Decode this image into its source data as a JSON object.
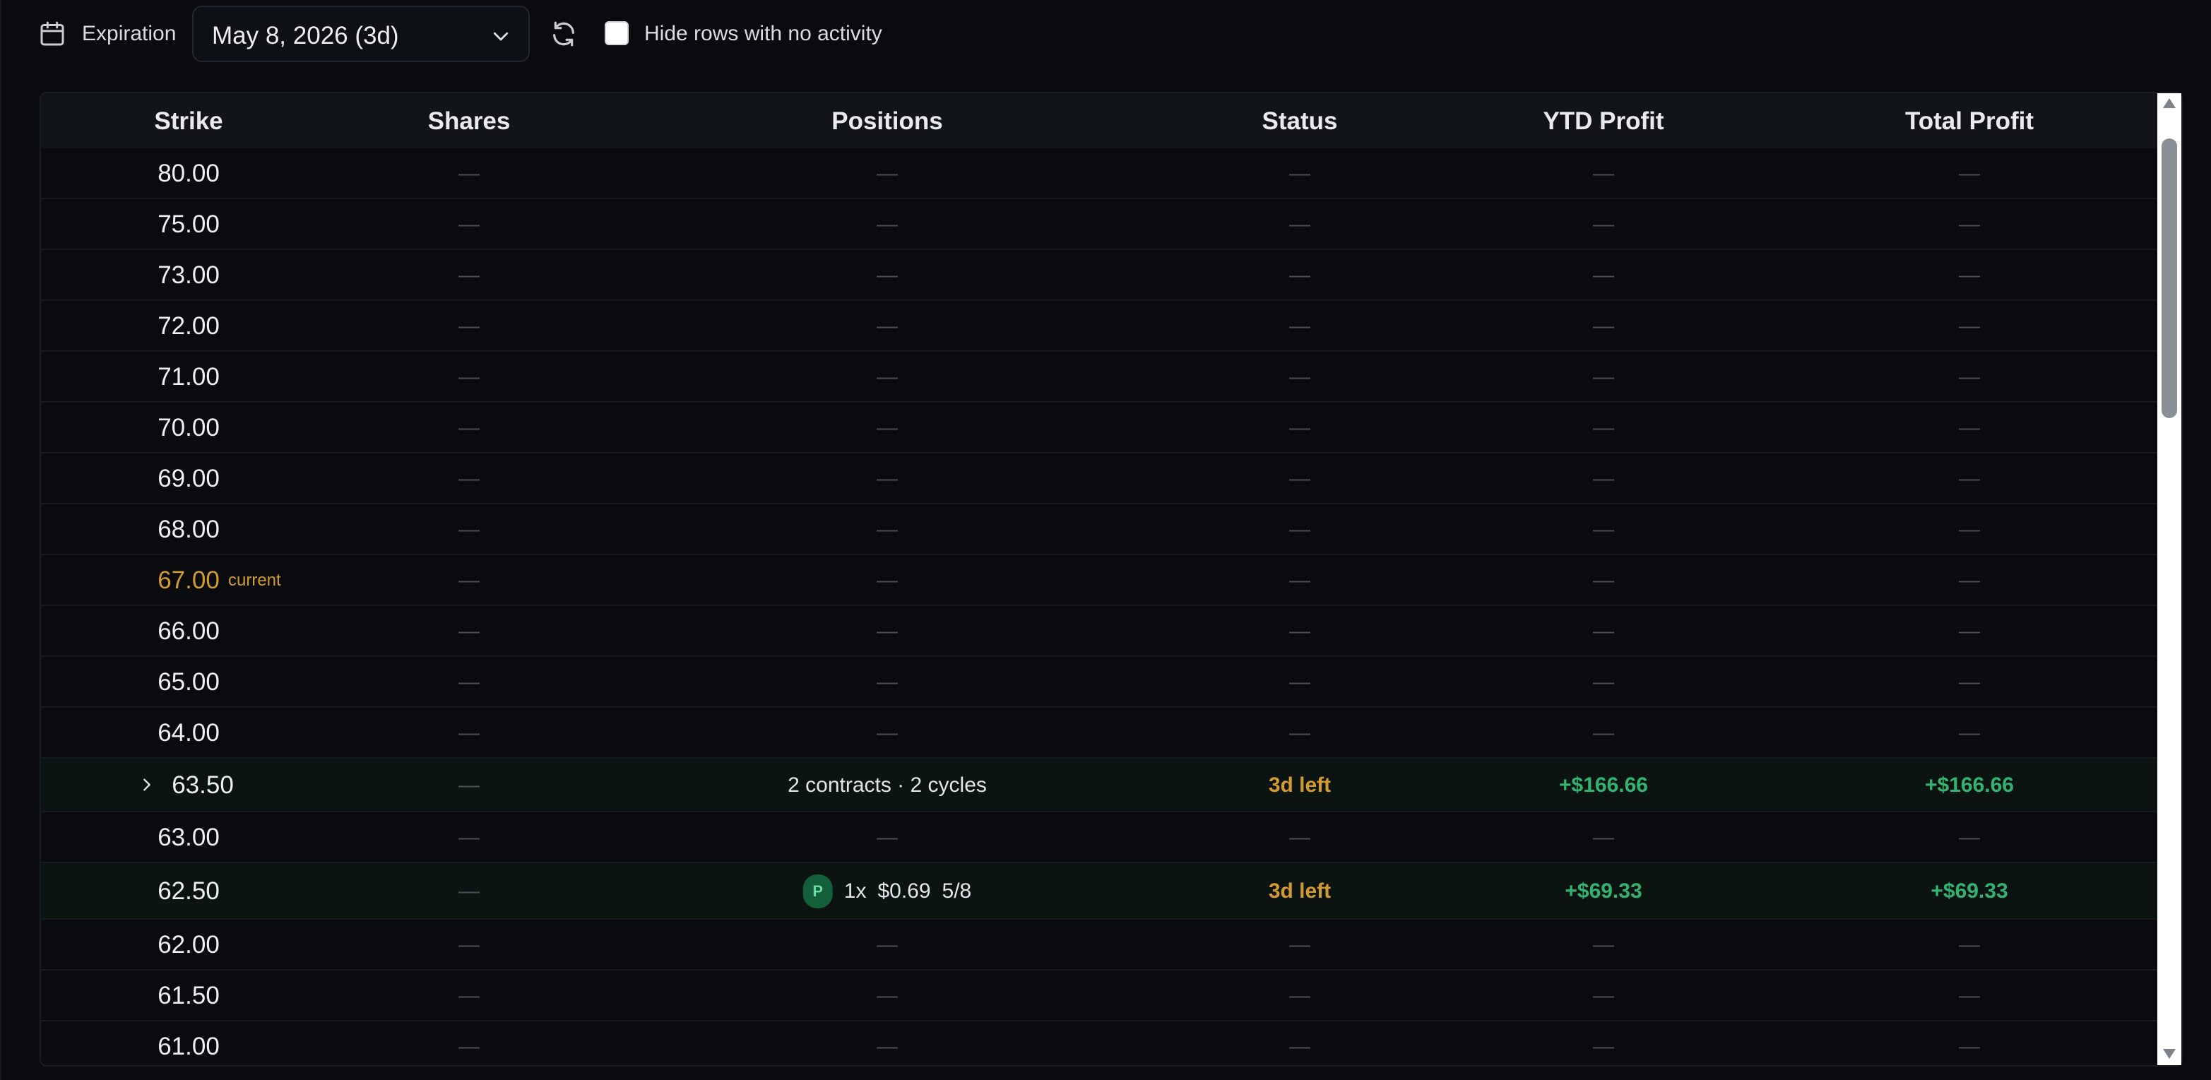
{
  "toolbar": {
    "calendar_icon": "calendar-icon",
    "expiration_label": "Expiration",
    "expiration_value": "May 8, 2026 (3d)",
    "chevron_icon": "chevron-down-icon",
    "refresh_icon": "refresh-icon",
    "hide_rows_label": "Hide rows with no activity",
    "hide_rows_checked": false
  },
  "table": {
    "columns": [
      "Strike",
      "Shares",
      "Positions",
      "Status",
      "YTD Profit",
      "Total Profit"
    ],
    "current_label": "current",
    "rows": [
      {
        "strike": "80.00",
        "shares": "—",
        "positions": "—",
        "status": "—",
        "ytd": "—",
        "total": "—"
      },
      {
        "strike": "75.00",
        "shares": "—",
        "positions": "—",
        "status": "—",
        "ytd": "—",
        "total": "—"
      },
      {
        "strike": "73.00",
        "shares": "—",
        "positions": "—",
        "status": "—",
        "ytd": "—",
        "total": "—"
      },
      {
        "strike": "72.00",
        "shares": "—",
        "positions": "—",
        "status": "—",
        "ytd": "—",
        "total": "—"
      },
      {
        "strike": "71.00",
        "shares": "—",
        "positions": "—",
        "status": "—",
        "ytd": "—",
        "total": "—"
      },
      {
        "strike": "70.00",
        "shares": "—",
        "positions": "—",
        "status": "—",
        "ytd": "—",
        "total": "—"
      },
      {
        "strike": "69.00",
        "shares": "—",
        "positions": "—",
        "status": "—",
        "ytd": "—",
        "total": "—"
      },
      {
        "strike": "68.00",
        "shares": "—",
        "positions": "—",
        "status": "—",
        "ytd": "—",
        "total": "—"
      },
      {
        "strike": "67.00",
        "current": true,
        "shares": "—",
        "positions": "—",
        "status": "—",
        "ytd": "—",
        "total": "—"
      },
      {
        "strike": "66.00",
        "shares": "—",
        "positions": "—",
        "status": "—",
        "ytd": "—",
        "total": "—"
      },
      {
        "strike": "65.00",
        "shares": "—",
        "positions": "—",
        "status": "—",
        "ytd": "—",
        "total": "—"
      },
      {
        "strike": "64.00",
        "shares": "—",
        "positions": "—",
        "status": "—",
        "ytd": "—",
        "total": "—"
      },
      {
        "strike": "63.50",
        "expandable": true,
        "shares": "—",
        "positions": "2 contracts · 2 cycles",
        "status": "3d left",
        "ytd": "+$166.66",
        "total": "+$166.66"
      },
      {
        "strike": "63.00",
        "shares": "—",
        "positions": "—",
        "status": "—",
        "ytd": "—",
        "total": "—"
      },
      {
        "strike": "62.50",
        "shares": "—",
        "position_detail": {
          "badge": "P",
          "qty": "1x",
          "price": "$0.69",
          "date": "5/8"
        },
        "status": "3d left",
        "ytd": "+$69.33",
        "total": "+$69.33"
      },
      {
        "strike": "62.00",
        "shares": "—",
        "positions": "—",
        "status": "—",
        "ytd": "—",
        "total": "—"
      },
      {
        "strike": "61.50",
        "shares": "—",
        "positions": "—",
        "status": "—",
        "ytd": "—",
        "total": "—"
      },
      {
        "strike": "61.00",
        "shares": "—",
        "positions": "—",
        "status": "—",
        "ytd": "—",
        "total": "—"
      }
    ]
  },
  "colors": {
    "background": "#090b0e",
    "header": "#111519",
    "current": "#d39a2f",
    "status": "#d39a2f",
    "profit": "#33b372",
    "dash": "#4a4f57",
    "badge_bg": "#135f3a"
  }
}
